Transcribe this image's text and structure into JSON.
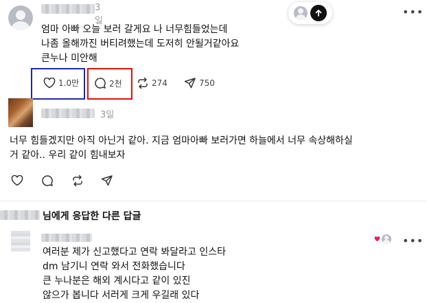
{
  "post": {
    "time": "3일",
    "text_lines": [
      "엄마 아빠 오늘 보러 갈게요 나 너무힘들었는데",
      "나좀 올해까진 버티려했는데 도저히 안될거같아요",
      "큰누나 미안해"
    ],
    "likes": "1.0만",
    "comments": "2천",
    "reposts": "274",
    "shares": "750"
  },
  "reply": {
    "time": "3일",
    "text_lines": [
      "너무 힘들겠지만 아직 아닌거 같아. 지금 엄마아빠 보러가면 하늘에서 너무 속상해하실",
      "거 같아.. 우리 같이 힘내보자"
    ]
  },
  "section": {
    "heading": "님에게 응답한 다른 답글"
  },
  "second_reply": {
    "text_lines": [
      "여러분 제가 신고했다고 연락 봐달라고 인스타",
      "dm 남기니 연락 와서 전화했습니다",
      "큰 누나분은 해외 계시다고 같이 있진",
      "않으가 봅니다 서러게 크게 우길래 있다"
    ]
  },
  "icons": {
    "heart": "heart-icon",
    "comment": "comment-icon",
    "repost": "repost-icon",
    "share": "share-icon",
    "more": "more-icon",
    "scroll_top": "arrow-up-icon"
  },
  "colors": {
    "annotation_blue": "#1a2aa8",
    "annotation_red": "#d11111",
    "like_heart": "#e0245e"
  }
}
